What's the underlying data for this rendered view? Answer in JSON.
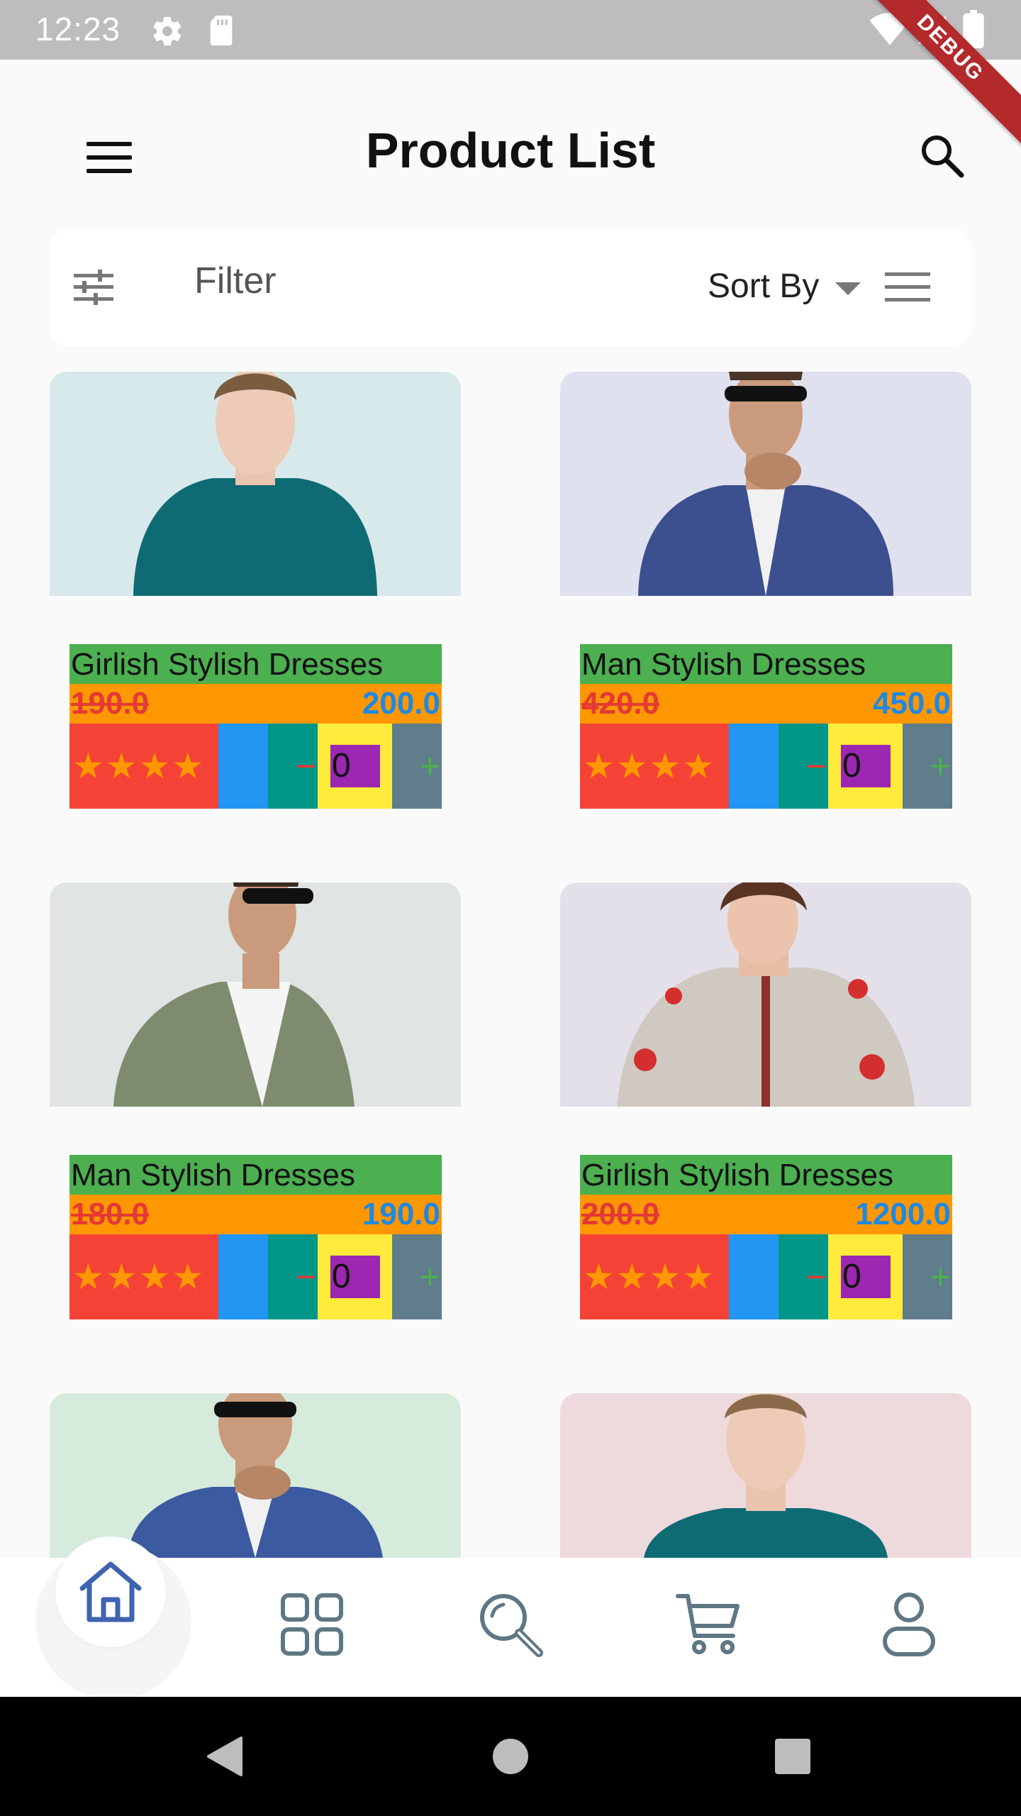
{
  "status_bar": {
    "time": "12:23",
    "debug_label": "DEBUG",
    "icons": [
      "gear-icon",
      "sd-card-icon",
      "wifi-icon",
      "signal-icon",
      "battery-icon"
    ]
  },
  "app_bar": {
    "title": "Product List",
    "icons": [
      "menu-icon",
      "search-icon"
    ]
  },
  "filter_bar": {
    "filter_label": "Filter",
    "sort_label": "Sort By",
    "icons": [
      "tune-icon",
      "dropdown-caret-icon",
      "list-view-icon"
    ]
  },
  "products": [
    {
      "name": "Girlish Stylish Dresses",
      "old_price": "190.0",
      "new_price": "200.0",
      "rating": 4,
      "quantity": "0",
      "image_bg": "#d8e9ec"
    },
    {
      "name": "Man Stylish Dresses",
      "old_price": "420.0",
      "new_price": "450.0",
      "rating": 4,
      "quantity": "0",
      "image_bg": "#e0e1ef"
    },
    {
      "name": "Man Stylish Dresses",
      "old_price": "180.0",
      "new_price": "190.0",
      "rating": 4,
      "quantity": "0",
      "image_bg": "#e0e4e2"
    },
    {
      "name": "Girlish Stylish Dresses",
      "old_price": "200.0",
      "new_price": "1200.0",
      "rating": 4,
      "quantity": "0",
      "image_bg": "#e3e0ea"
    },
    {
      "name": "",
      "old_price": "",
      "new_price": "",
      "image_bg": "#d6ebdc"
    },
    {
      "name": "",
      "old_price": "",
      "new_price": "",
      "image_bg": "#eedadd"
    }
  ],
  "quantity_controls": {
    "minus": "−",
    "plus": "+"
  },
  "star_glyph": "★",
  "bottom_nav": {
    "items": [
      "home-icon",
      "categories-icon",
      "explore-icon",
      "cart-icon",
      "profile-icon"
    ],
    "active": "home-icon",
    "active_color": "#3f63b0",
    "inactive_color": "#5f7784"
  },
  "system_nav": [
    "back-icon",
    "home-circle-icon",
    "recents-icon"
  ],
  "colors": {
    "name_bg": "#4caf50",
    "price_bg": "#ff9800",
    "old_price": "#e53935",
    "new_price": "#1e88e5",
    "rating_bg": "#f44336",
    "star": "#ff9800",
    "qty_bg": "#ffeb3b",
    "qty_box": "#9c27b0"
  }
}
